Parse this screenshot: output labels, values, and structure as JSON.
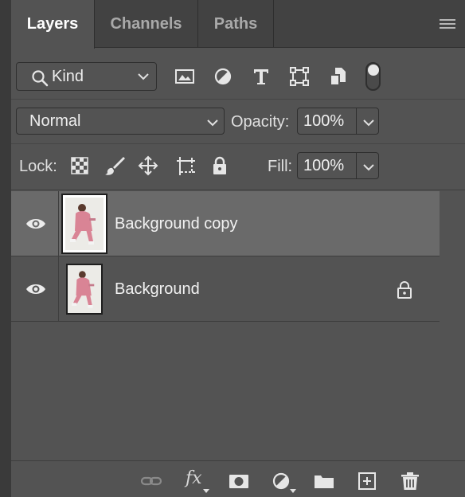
{
  "tabs": [
    {
      "label": "Layers",
      "active": true
    },
    {
      "label": "Channels",
      "active": false
    },
    {
      "label": "Paths",
      "active": false
    }
  ],
  "panel_menu_icon": "hamburger-icon",
  "filter": {
    "kind_label": "Kind",
    "filter_icons": [
      "image-filter-icon",
      "adjustment-filter-icon",
      "type-filter-icon",
      "shape-filter-icon",
      "smart-object-filter-icon"
    ],
    "filter_toggle_on": true
  },
  "blend": {
    "mode": "Normal",
    "opacity_label": "Opacity:",
    "opacity_value": "100%"
  },
  "lock": {
    "label": "Lock:",
    "icons": [
      "lock-transparent-pixels-icon",
      "lock-image-pixels-icon",
      "lock-position-icon",
      "lock-artboard-icon",
      "lock-all-icon"
    ],
    "fill_label": "Fill:",
    "fill_value": "100%"
  },
  "layers": [
    {
      "name": "Background copy",
      "visible": true,
      "selected": true,
      "locked": false
    },
    {
      "name": "Background",
      "visible": true,
      "selected": false,
      "locked": true
    }
  ],
  "bottom_icons": [
    "link-layers-icon",
    "fx-icon",
    "layer-mask-icon",
    "adjustment-layer-icon",
    "group-folder-icon",
    "new-layer-icon",
    "delete-icon"
  ],
  "bottom_fx_label": "fx",
  "colors": {
    "panel": "#535353",
    "selected_row": "#6a6a6a",
    "tabbar": "#424242"
  }
}
